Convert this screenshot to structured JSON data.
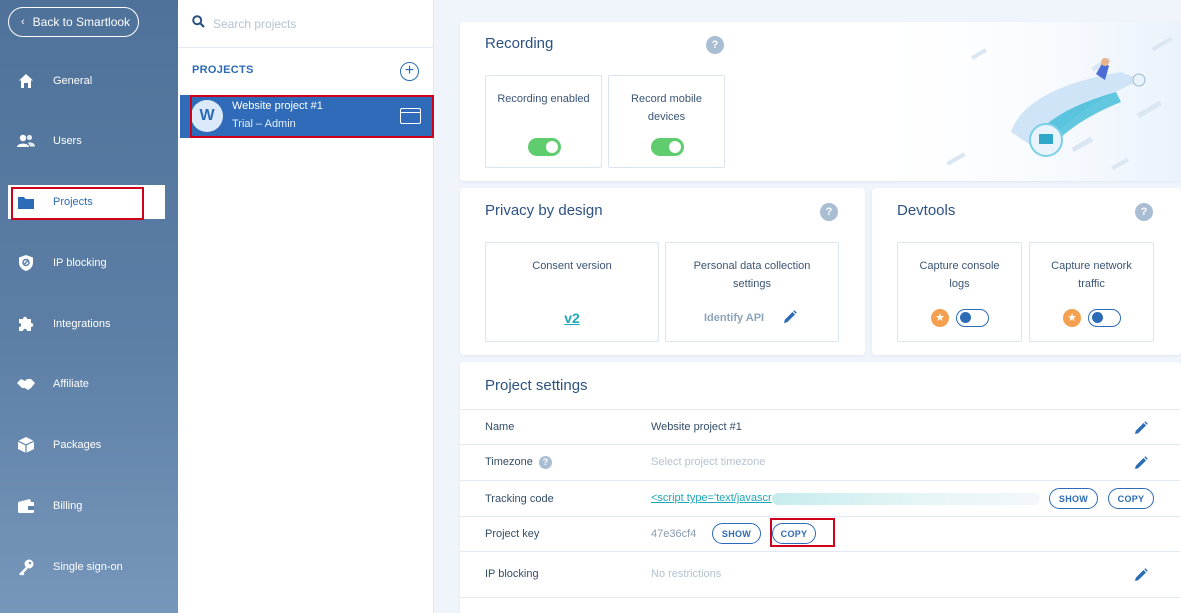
{
  "nav": {
    "back_label": "Back to Smartlook",
    "items": [
      {
        "label": "General",
        "icon": "home-icon"
      },
      {
        "label": "Users",
        "icon": "users-icon"
      },
      {
        "label": "Projects",
        "icon": "folder-icon"
      },
      {
        "label": "IP blocking",
        "icon": "shield-icon"
      },
      {
        "label": "Integrations",
        "icon": "puzzle-icon"
      },
      {
        "label": "Affiliate",
        "icon": "handshake-icon"
      },
      {
        "label": "Packages",
        "icon": "package-icon"
      },
      {
        "label": "Billing",
        "icon": "wallet-icon"
      },
      {
        "label": "Single sign-on",
        "icon": "key-icon"
      }
    ],
    "active": "Projects"
  },
  "projects": {
    "search_placeholder": "Search projects",
    "header": "PROJECTS",
    "list": [
      {
        "initial": "W",
        "name": "Website project #1",
        "role": "Trial – Admin"
      }
    ]
  },
  "recording": {
    "title": "Recording",
    "tiles": [
      {
        "label": "Recording enabled",
        "toggle": "on"
      },
      {
        "label": "Record mobile devices",
        "toggle": "on"
      }
    ]
  },
  "privacy": {
    "title": "Privacy by design",
    "consent_label": "Consent version",
    "consent_value": "v2",
    "personal_label": "Personal data collection settings",
    "personal_value": "Identify API"
  },
  "devtools": {
    "title": "Devtools",
    "tiles": [
      {
        "label": "Capture console logs",
        "toggle": "off"
      },
      {
        "label": "Capture network traffic",
        "toggle": "off"
      }
    ]
  },
  "settings": {
    "title": "Project settings",
    "name_label": "Name",
    "name_value": "Website project #1",
    "timezone_label": "Timezone",
    "timezone_value": "Select project timezone",
    "tracking_label": "Tracking code",
    "tracking_value": "<script type='text/javascr",
    "key_label": "Project key",
    "key_value": "47e36cf4",
    "ip_label": "IP blocking",
    "ip_value": "No restrictions",
    "show": "SHOW",
    "copy": "COPY"
  },
  "colors": {
    "accent": "#2c6bb5",
    "toggle_on": "#5fcc6e",
    "highlight": "#d0021b",
    "star": "#f4a04f"
  }
}
